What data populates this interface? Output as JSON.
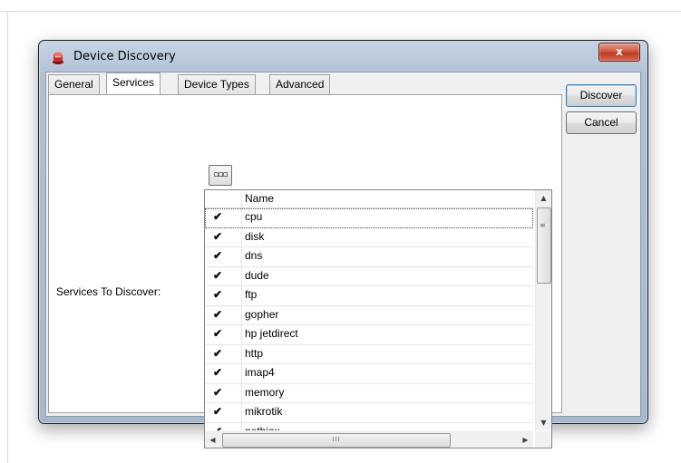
{
  "window": {
    "title": "Device Discovery",
    "close_label": "x"
  },
  "tabs": [
    {
      "label": "General",
      "active": false
    },
    {
      "label": "Services",
      "active": true
    },
    {
      "label": "Device Types",
      "active": false
    },
    {
      "label": "Advanced",
      "active": false
    }
  ],
  "services": {
    "label": "Services To Discover:",
    "dots_button_label": "▫▫▫",
    "list": {
      "column_header": "Name",
      "rows": [
        {
          "checked": true,
          "name": "cpu"
        },
        {
          "checked": true,
          "name": "disk"
        },
        {
          "checked": true,
          "name": "dns"
        },
        {
          "checked": true,
          "name": "dude"
        },
        {
          "checked": true,
          "name": "ftp"
        },
        {
          "checked": true,
          "name": "gopher"
        },
        {
          "checked": true,
          "name": "hp jetdirect"
        },
        {
          "checked": true,
          "name": "http"
        },
        {
          "checked": true,
          "name": "imap4"
        },
        {
          "checked": true,
          "name": "memory"
        },
        {
          "checked": true,
          "name": "mikrotik"
        },
        {
          "checked": true,
          "name": "nethiax"
        }
      ]
    },
    "scroll": {
      "up_arrow": "▲",
      "down_arrow": "▼",
      "left_arrow": "◀",
      "right_arrow": "▶",
      "vgrip": "≡",
      "hgrip": "III"
    }
  },
  "buttons": {
    "discover": "Discover",
    "cancel": "Cancel"
  },
  "check_glyph": "✔",
  "colors": {
    "close_button": "#c0391f",
    "app_icon": "#cc2222"
  }
}
